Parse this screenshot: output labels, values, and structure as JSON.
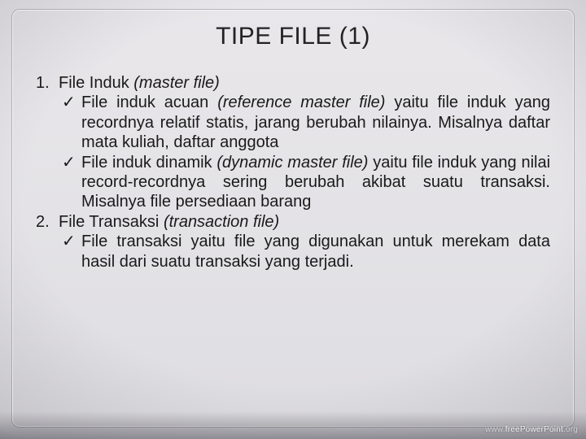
{
  "title": "TIPE FILE (1)",
  "items": [
    {
      "num": "1.",
      "head_plain": "File Induk ",
      "head_italic": "(master file)",
      "subs": [
        {
          "lead": "File induk acuan ",
          "italic": "(reference master file) ",
          "rest": "yaitu file induk yang recordnya relatif statis, jarang berubah nilainya. Misalnya daftar mata kuliah, daftar anggota"
        },
        {
          "lead": "File induk dinamik ",
          "italic": "(dynamic master file) ",
          "rest": "yaitu file induk yang nilai record-recordnya sering berubah akibat suatu transaksi. Misalnya file persediaan barang"
        }
      ]
    },
    {
      "num": "2.",
      "head_plain": "File Transaksi ",
      "head_italic": "(transaction file)",
      "subs": [
        {
          "lead": "",
          "italic": "",
          "rest": "File transaksi yaitu file yang digunakan untuk merekam data hasil dari suatu transaksi yang terjadi."
        }
      ]
    }
  ],
  "check": "✓",
  "credit": {
    "www": "www.",
    "brand": "freePowerPoint",
    "tld": ".org"
  }
}
